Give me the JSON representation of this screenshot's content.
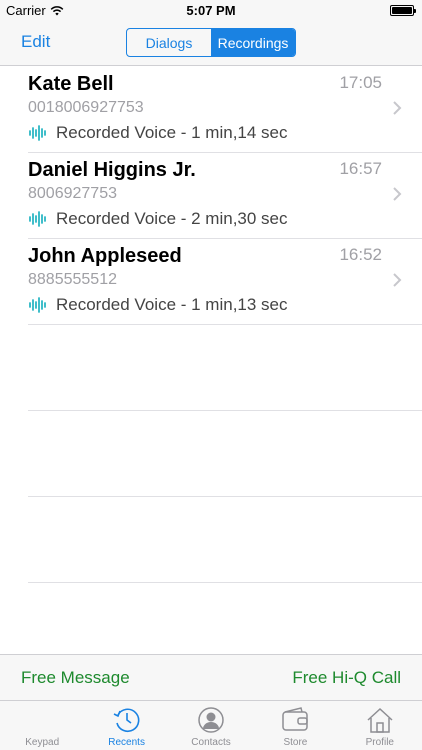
{
  "status_bar": {
    "carrier": "Carrier",
    "time": "5:07 PM"
  },
  "nav": {
    "edit_label": "Edit",
    "segments": [
      {
        "label": "Dialogs",
        "active": false
      },
      {
        "label": "Recordings",
        "active": true
      }
    ]
  },
  "recordings": [
    {
      "name": "Kate Bell",
      "number": "0018006927753",
      "recorded": "Recorded Voice - 1 min,14 sec",
      "time": "17:05"
    },
    {
      "name": "Daniel Higgins Jr.",
      "number": "8006927753",
      "recorded": "Recorded Voice - 2 min,30 sec",
      "time": "16:57"
    },
    {
      "name": "John Appleseed",
      "number": "8885555512",
      "recorded": "Recorded Voice - 1 min,13 sec",
      "time": "16:52"
    }
  ],
  "promo": {
    "left_label": "Free Message",
    "right_label": "Free Hi-Q Call"
  },
  "tabs": [
    {
      "label": "Keypad",
      "icon": "keypad-icon",
      "active": false
    },
    {
      "label": "Recents",
      "icon": "recents-clock-icon",
      "active": true
    },
    {
      "label": "Contacts",
      "icon": "contacts-person-icon",
      "active": false
    },
    {
      "label": "Store",
      "icon": "wallet-icon",
      "active": false
    },
    {
      "label": "Profile",
      "icon": "home-icon",
      "active": false
    }
  ],
  "colors": {
    "accent": "#1a82e2",
    "promo_green": "#1e8a2e",
    "waveform": "#2bb7c4",
    "secondary_text": "#a0a0a5"
  }
}
